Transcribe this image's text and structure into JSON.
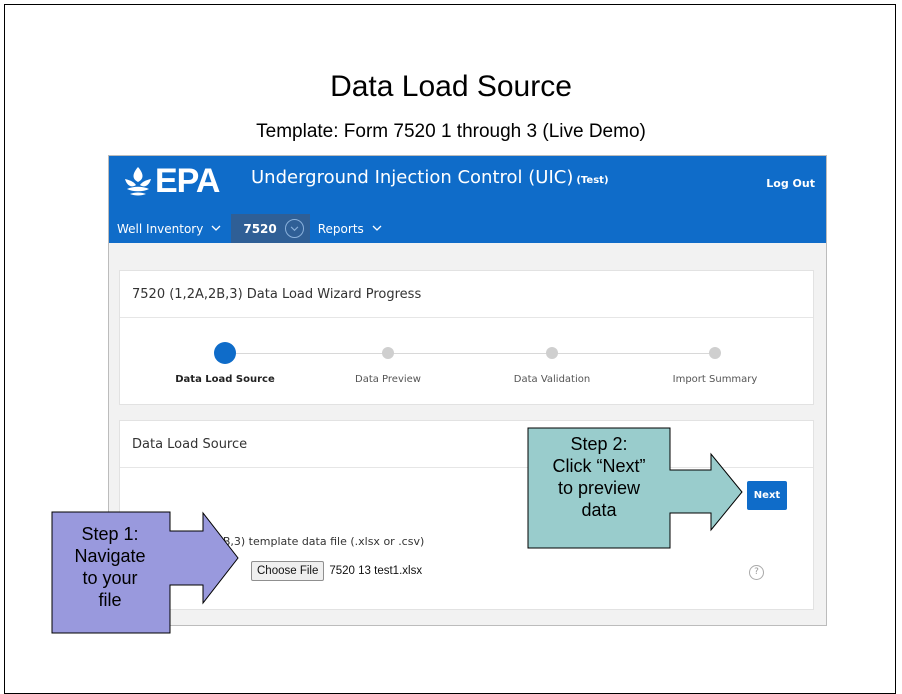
{
  "slide": {
    "title": "Data Load Source",
    "subtitle": "Template: Form 7520 1 through 3 (Live Demo)"
  },
  "app": {
    "logo_text": "EPA",
    "title": "Underground Injection Control (UIC)",
    "environment": "(Test)",
    "logout_label": "Log Out",
    "colors": {
      "header": "#0f6cc9",
      "active_nav": "#2f5f96",
      "primary_button": "#0f6cc9"
    },
    "nav": [
      {
        "label": "Well Inventory",
        "icon": "chevron-down-icon"
      },
      {
        "label": "7520",
        "icon": "circle-chevron-down-icon",
        "active": true
      },
      {
        "label": "Reports",
        "icon": "chevron-down-icon"
      }
    ]
  },
  "wizard": {
    "title": "7520 (1,2A,2B,3) Data Load Wizard Progress",
    "steps": [
      {
        "label": "Data Load Source",
        "current": true
      },
      {
        "label": "Data Preview",
        "current": false
      },
      {
        "label": "Data Validation",
        "current": false
      },
      {
        "label": "Import Summary",
        "current": false
      }
    ]
  },
  "source": {
    "title": "Data Load Source",
    "next_label": "Next",
    "file_label": "the 7520 (1,2A,2B,3) template data file (.xlsx or .csv)",
    "choose_file_label": "Choose File",
    "file_name": "7520 13 test1.xlsx",
    "help_icon": "question-circle-icon"
  },
  "callouts": {
    "step1": {
      "lines": [
        "Step 1:",
        "Navigate",
        "to your",
        "file"
      ],
      "fill": "#9999dd"
    },
    "step2": {
      "lines": [
        "Step 2:",
        "Click “Next”",
        "to preview",
        "data"
      ],
      "fill": "#99cccc"
    }
  }
}
